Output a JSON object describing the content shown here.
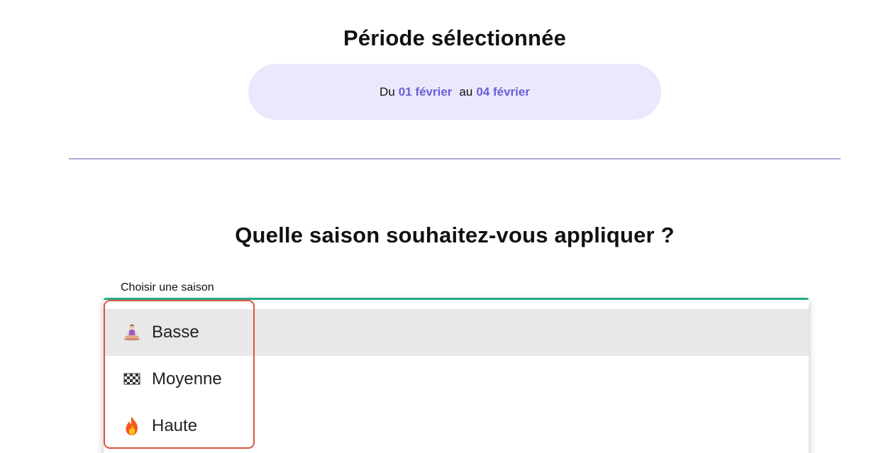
{
  "period": {
    "title": "Période sélectionnée",
    "from_prefix": "Du",
    "from_date": "01 février",
    "to_prefix": "au",
    "to_date": "04 février"
  },
  "season": {
    "question": "Quelle saison souhaitez-vous appliquer ?",
    "field_label": "Choisir une saison",
    "options": [
      {
        "icon": "meditating-person-icon",
        "label": "Basse",
        "highlighted": true
      },
      {
        "icon": "checkered-flag-icon",
        "label": "Moyenne",
        "highlighted": false
      },
      {
        "icon": "fire-icon",
        "label": "Haute",
        "highlighted": false
      }
    ]
  },
  "colors": {
    "accent_purple": "#6a5fd8",
    "pill_background": "#ebe8fc",
    "select_focus_green": "#29b38f",
    "annotation_red": "#d9553d"
  }
}
